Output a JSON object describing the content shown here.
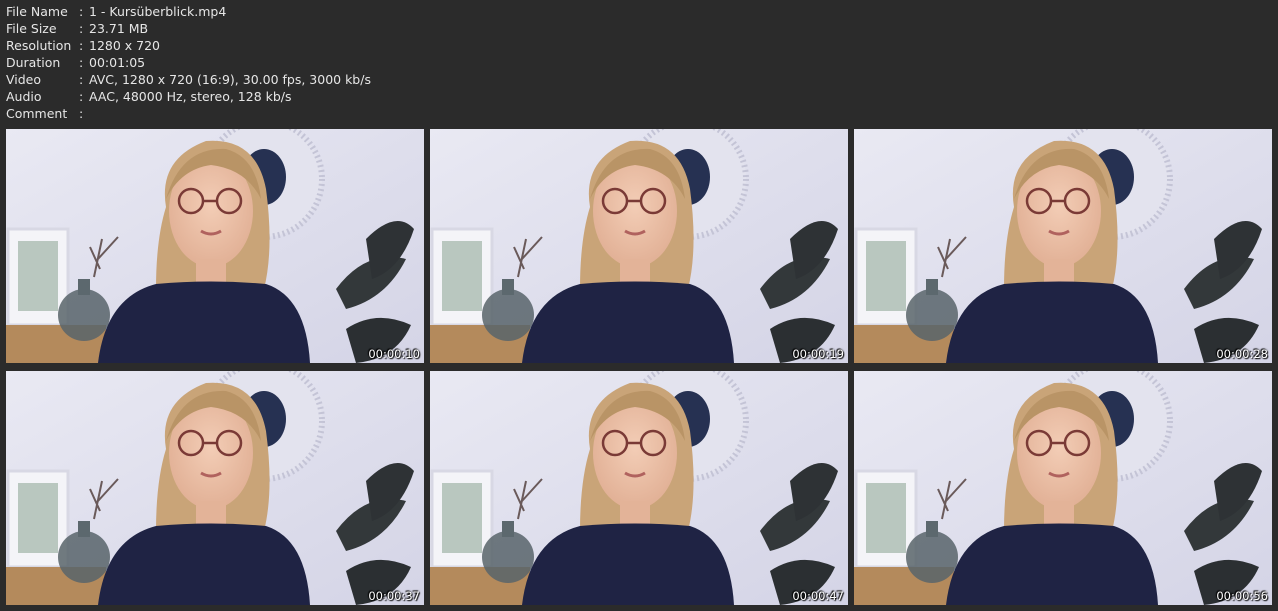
{
  "info": {
    "rows": [
      {
        "key": "File Name",
        "sep": ":",
        "value": "1 - Kursüberblick.mp4"
      },
      {
        "key": "File Size",
        "sep": ":",
        "value": "23.71 MB"
      },
      {
        "key": "Resolution",
        "sep": ":",
        "value": "1280 x 720"
      },
      {
        "key": "Duration",
        "sep": ":",
        "value": "00:01:05"
      },
      {
        "key": "Video",
        "sep": ":",
        "value": "AVC, 1280 x 720 (16:9), 30.00 fps, 3000 kb/s"
      },
      {
        "key": "Audio",
        "sep": ":",
        "value": "AAC, 48000 Hz, stereo, 128 kb/s"
      },
      {
        "key": "Comment",
        "sep": ":",
        "value": ""
      }
    ]
  },
  "thumbnails": [
    {
      "timestamp": "00:00:10"
    },
    {
      "timestamp": "00:00:19"
    },
    {
      "timestamp": "00:00:28"
    },
    {
      "timestamp": "00:00:37"
    },
    {
      "timestamp": "00:00:47"
    },
    {
      "timestamp": "00:00:56"
    }
  ],
  "colors": {
    "background": "#2b2b2b",
    "wall": "#d4d4e6",
    "hair": "#c9a478",
    "sweater": "#1f2344"
  }
}
